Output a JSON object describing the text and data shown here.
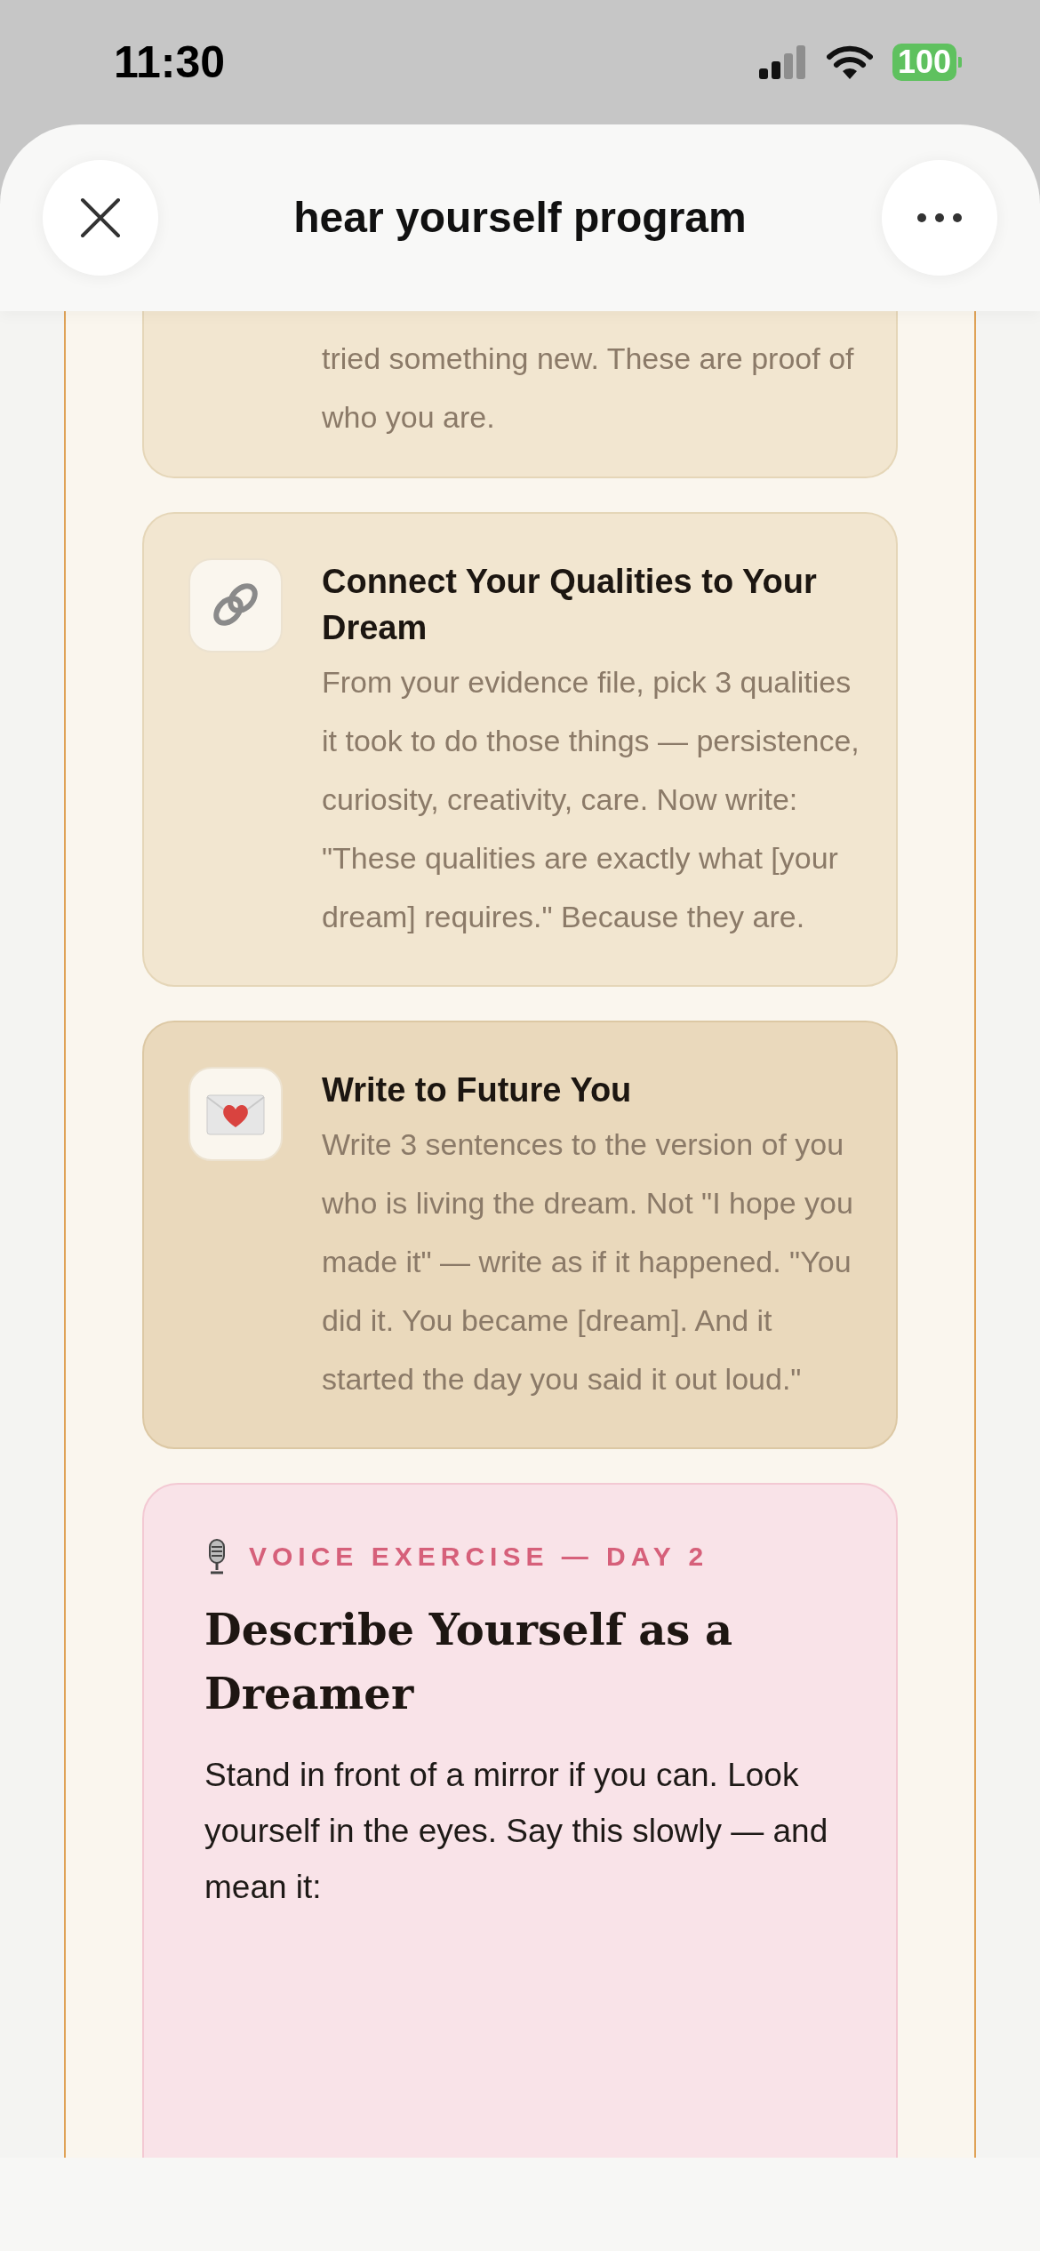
{
  "status_bar": {
    "time": "11:30",
    "battery": "100"
  },
  "header": {
    "title": "hear yourself program"
  },
  "continued_card": {
    "body": "tried something new. These are proof of who you are."
  },
  "steps": [
    {
      "title": "Connect Your Qualities to Your Dream",
      "body": "From your evidence file, pick 3 qualities it took to do those things — persistence, curiosity, creativity, care. Now write: \"These qualities are exactly what [your dream] requires.\" Because they are.",
      "highlighted": false
    },
    {
      "title": "Write to Future You",
      "body": "Write 3 sentences to the version of you who is living the dream. Not \"I hope you made it\" — write as if it happened. \"You did it. You became [dream]. And it started the day you said it out loud.\"",
      "highlighted": true
    }
  ],
  "voice_exercise": {
    "label": "VOICE EXERCISE — DAY 2",
    "title": "Describe Yourself as a Dreamer",
    "body": "Stand in front of a mirror if you can. Look yourself in the eyes. Say this slowly — and mean it:"
  }
}
